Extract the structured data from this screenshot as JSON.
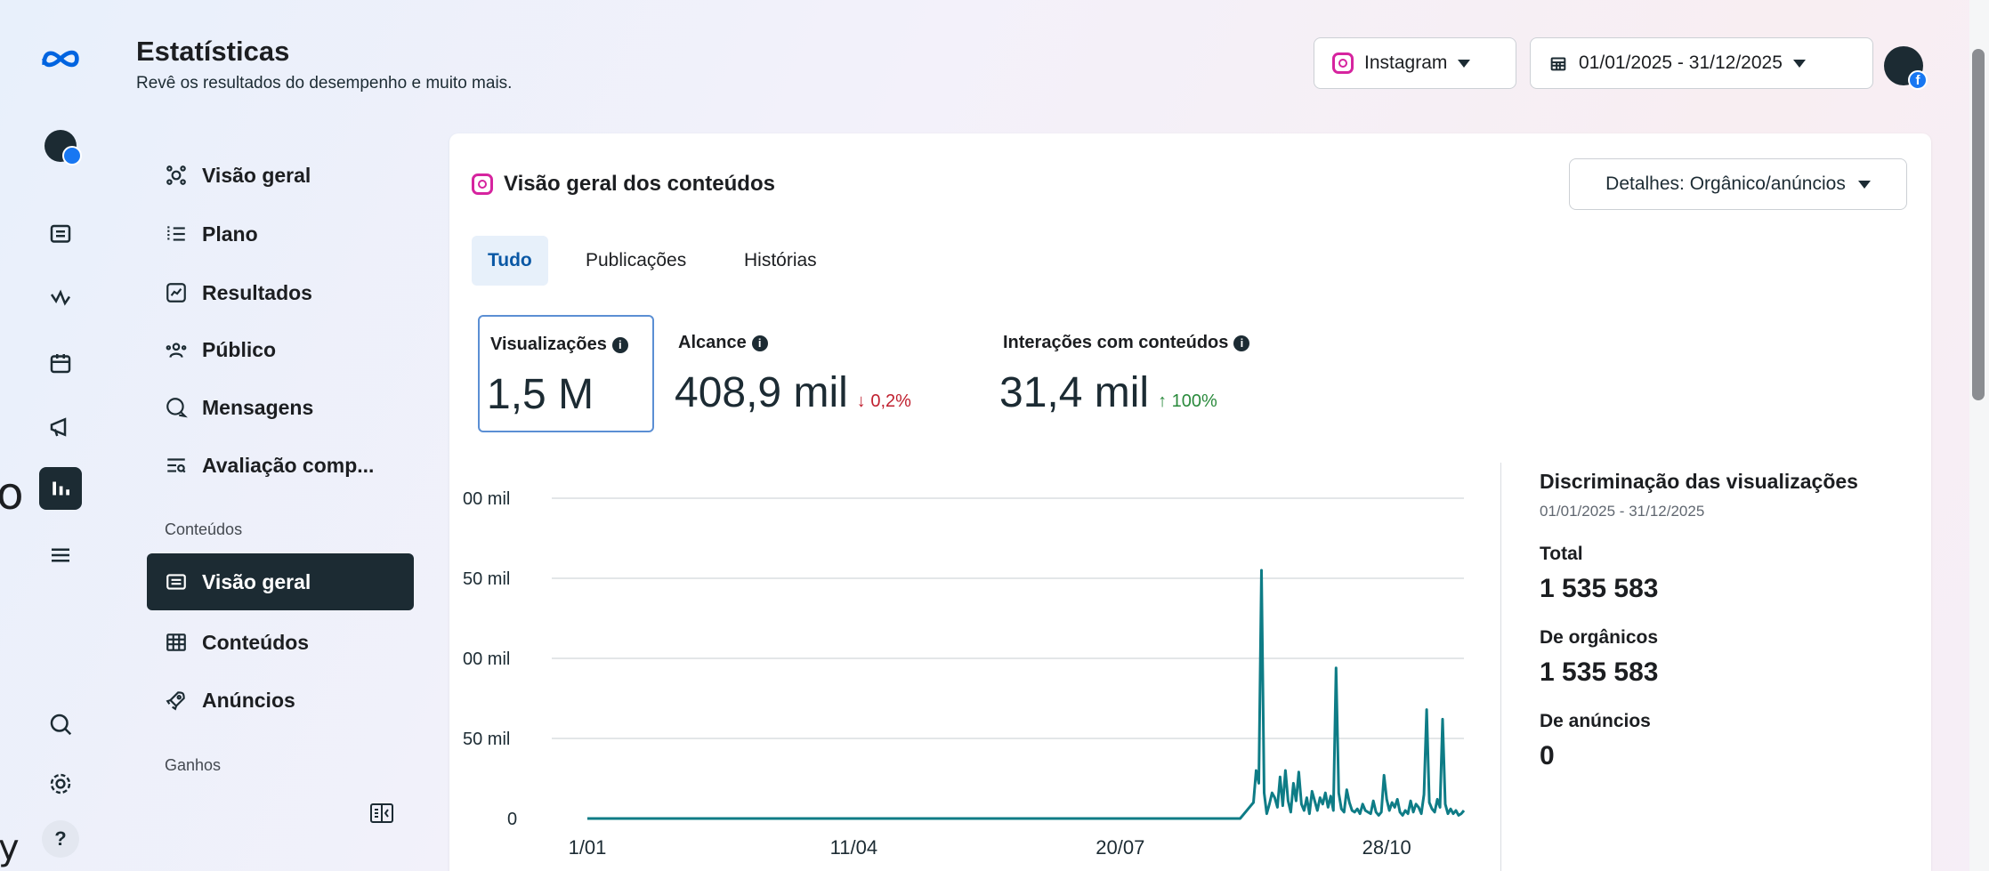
{
  "header": {
    "title": "Estatísticas",
    "subtitle": "Revê os resultados do desempenho e muito mais.",
    "platform": "Instagram",
    "date_range": "01/01/2025 - 31/12/2025"
  },
  "overflow_left": {
    "char1": "o",
    "char2": "y"
  },
  "rail": {
    "help_label": "?"
  },
  "nav": {
    "items": [
      {
        "label": "Visão geral",
        "icon": "overview-icon"
      },
      {
        "label": "Plano",
        "icon": "plan-icon"
      },
      {
        "label": "Resultados",
        "icon": "results-icon"
      },
      {
        "label": "Público",
        "icon": "audience-icon"
      },
      {
        "label": "Mensagens",
        "icon": "messages-icon"
      },
      {
        "label": "Avaliação comp...",
        "icon": "benchmark-icon"
      }
    ],
    "section_contents": "Conteúdos",
    "content_items": [
      {
        "label": "Visão geral",
        "icon": "content-overview-icon",
        "active": true
      },
      {
        "label": "Conteúdos",
        "icon": "content-table-icon"
      },
      {
        "label": "Anúncios",
        "icon": "ads-rocket-icon"
      }
    ],
    "section_earnings": "Ganhos"
  },
  "card": {
    "title": "Visão geral dos conteúdos",
    "details_button": "Detalhes: Orgânico/anúncios",
    "tabs": [
      "Tudo",
      "Publicações",
      "Histórias"
    ],
    "active_tab": "Tudo",
    "metrics": [
      {
        "label": "Visualizações",
        "value": "1,5 M",
        "delta": ""
      },
      {
        "label": "Alcance",
        "value": "408,9 mil",
        "delta": "↓ 0,2%"
      },
      {
        "label": "Interações com conteúdos",
        "value": "31,4 mil",
        "delta": "↑ 100%"
      }
    ]
  },
  "breakdown": {
    "title": "Discriminação das visualizações",
    "range": "01/01/2025 - 31/12/2025",
    "total_label": "Total",
    "total_value": "1 535 583",
    "organic_label": "De orgânicos",
    "organic_value": "1 535 583",
    "ads_label": "De anúncios",
    "ads_value": "0"
  },
  "colors": {
    "accent_dark": "#1c2b33",
    "line": "#0e7c86",
    "tab_active": "#0a58a5",
    "up": "#2a8a3c",
    "down": "#c0202f"
  },
  "chart_data": {
    "type": "line",
    "y_tick_labels": [
      "00 mil",
      "50 mil",
      "00 mil",
      "50 mil",
      "0"
    ],
    "y_values": [
      200,
      150,
      100,
      50,
      0
    ],
    "x_tick_labels": [
      "1/01",
      "11/04",
      "20/07",
      "28/10"
    ],
    "series": [
      {
        "values": [
          0,
          0,
          0,
          0,
          0,
          0,
          0,
          0,
          0,
          0,
          0,
          0,
          0,
          0,
          0,
          0,
          0,
          0,
          0,
          0,
          0,
          0,
          0,
          0,
          0,
          0,
          0,
          0,
          0,
          0,
          0,
          0,
          0,
          0,
          0,
          0,
          0,
          0,
          0,
          0,
          0,
          0,
          0,
          0,
          0,
          0,
          0,
          0,
          0,
          0,
          0,
          0,
          0,
          0,
          0,
          0,
          0,
          0,
          0,
          0,
          0,
          0,
          0,
          0,
          0,
          0,
          0,
          0,
          0,
          0,
          0,
          0,
          0,
          0,
          0,
          0,
          0,
          0,
          0,
          0,
          0,
          0,
          0,
          0,
          0,
          0,
          0,
          0,
          0,
          0,
          0,
          0,
          0,
          0,
          0,
          0,
          0,
          0,
          0,
          0,
          0,
          0,
          0,
          0,
          0,
          0,
          0,
          0,
          0,
          0,
          0,
          0,
          0,
          0,
          0,
          0,
          0,
          0,
          0,
          0,
          0,
          0,
          0,
          0,
          0,
          0,
          0,
          0,
          0,
          0,
          0,
          0,
          0,
          0,
          0,
          0,
          0,
          0,
          0,
          0,
          0,
          0,
          0,
          0,
          0,
          0,
          0,
          0,
          0,
          0,
          0,
          0,
          0,
          0,
          0,
          0,
          0,
          0,
          0,
          0,
          0,
          0,
          0,
          0,
          0,
          0,
          0,
          0,
          0,
          0,
          0,
          0,
          0,
          0,
          0,
          0,
          0,
          0,
          0,
          0,
          0,
          0,
          0,
          0,
          0,
          0,
          0,
          0,
          0,
          0,
          0,
          0,
          0,
          0,
          0,
          0,
          0,
          0,
          0,
          0,
          0,
          0,
          0,
          0,
          0,
          0,
          0,
          0,
          0,
          0,
          0,
          0,
          0,
          0,
          0,
          0,
          0,
          0,
          0,
          0,
          0,
          0,
          0,
          0,
          0,
          0,
          0,
          0,
          0,
          0,
          0,
          0,
          0,
          0,
          0,
          0,
          0,
          0,
          0,
          0,
          0,
          0,
          0,
          0,
          0,
          0,
          2,
          4,
          6,
          8,
          10,
          30,
          22,
          155,
          16,
          3,
          9,
          16,
          13,
          7,
          26,
          8,
          30,
          11,
          4,
          22,
          11,
          29,
          9,
          5,
          13,
          3,
          17,
          11,
          5,
          13,
          9,
          16,
          7,
          14,
          5,
          94,
          16,
          6,
          4,
          18,
          10,
          5,
          4,
          6,
          3,
          9,
          5,
          4,
          3,
          11,
          4,
          2,
          4,
          27,
          12,
          5,
          10,
          7,
          12,
          4,
          2,
          5,
          3,
          11,
          4,
          9,
          7,
          3,
          15,
          68,
          10,
          6,
          4,
          12,
          7,
          62,
          9,
          3,
          6,
          3,
          5,
          2,
          3,
          5
        ]
      }
    ]
  }
}
